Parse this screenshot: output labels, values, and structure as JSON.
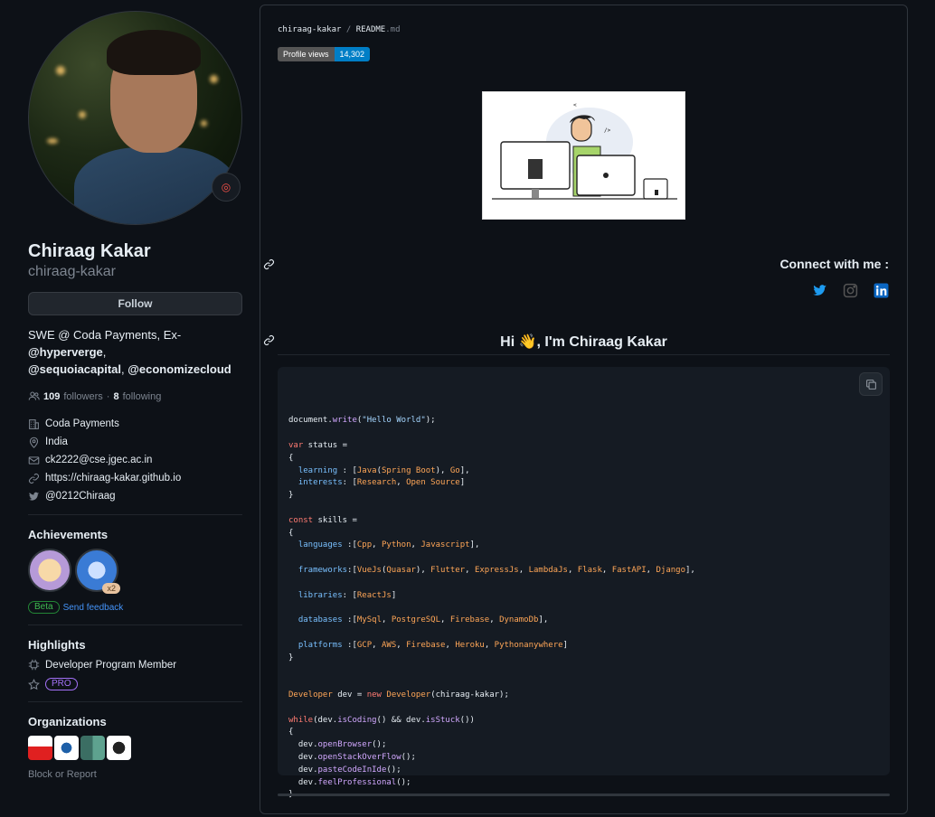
{
  "profile": {
    "name": "Chiraag Kakar",
    "login": "chiraag-kakar",
    "follow_label": "Follow",
    "bio_prefix": "SWE @ Coda Payments, Ex-",
    "bio_link1": "@hyperverge",
    "bio_comma": ",",
    "bio_link2": "@sequoiacapital",
    "bio_comma2": ", ",
    "bio_link3": "@economizecloud",
    "followers_count": "109",
    "followers_label": "followers",
    "dot": " · ",
    "following_count": "8",
    "following_label": "following",
    "company": "Coda Payments",
    "location": "India",
    "email": "ck2222@cse.jgec.ac.in",
    "website": "https://chiraag-kakar.github.io",
    "twitter": "@0212Chiraag"
  },
  "achievements": {
    "title": "Achievements",
    "badge_multiplier": "x2",
    "beta": "Beta",
    "feedback": "Send feedback"
  },
  "highlights": {
    "title": "Highlights",
    "item1": "Developer Program Member",
    "pro": "PRO"
  },
  "organizations": {
    "title": "Organizations",
    "block_report": "Block or Report"
  },
  "readme": {
    "owner": "chiraag-kakar",
    "sep": " / ",
    "file": "README",
    "ext": ".md",
    "views_label": "Profile views",
    "views_count": "14,302",
    "connect": "Connect with me :",
    "hi": "Hi 👋, I'm Chiraag Kakar"
  },
  "icons": {
    "twitter": "twitter-icon",
    "instagram": "instagram-icon",
    "linkedin": "linkedin-icon"
  },
  "colors": {
    "background": "#0d1117",
    "link": "#4493f8",
    "pro": "#a371f7",
    "beta": "#3fb950"
  },
  "code": {
    "lines": [
      "document.write(\"Hello World\");",
      "",
      "var status =",
      "{",
      "  learning : [Java(Spring Boot), Go],",
      "  interests: [Research, Open Source]",
      "}",
      "",
      "const skills =",
      "{",
      "  languages :[Cpp, Python, Javascript],",
      "",
      "  frameworks:[VueJs(Quasar), Flutter, ExpressJs, LambdaJs, Flask, FastAPI, Django],",
      "",
      "  libraries: [ReactJs]",
      "",
      "  databases :[MySql, PostgreSQL, Firebase, DynamoDb],",
      "",
      "  platforms :[GCP, AWS, Firebase, Heroku, Pythonanywhere]",
      "}",
      "",
      "",
      "Developer dev = new Developer(chiraag-kakar);",
      "",
      "while(dev.isCoding() && dev.isStuck())",
      "{",
      "  dev.openBrowser();",
      "  dev.openStackOverFlow();",
      "  dev.pasteCodeInIde();",
      "  dev.feelProfessional();",
      "}"
    ]
  }
}
